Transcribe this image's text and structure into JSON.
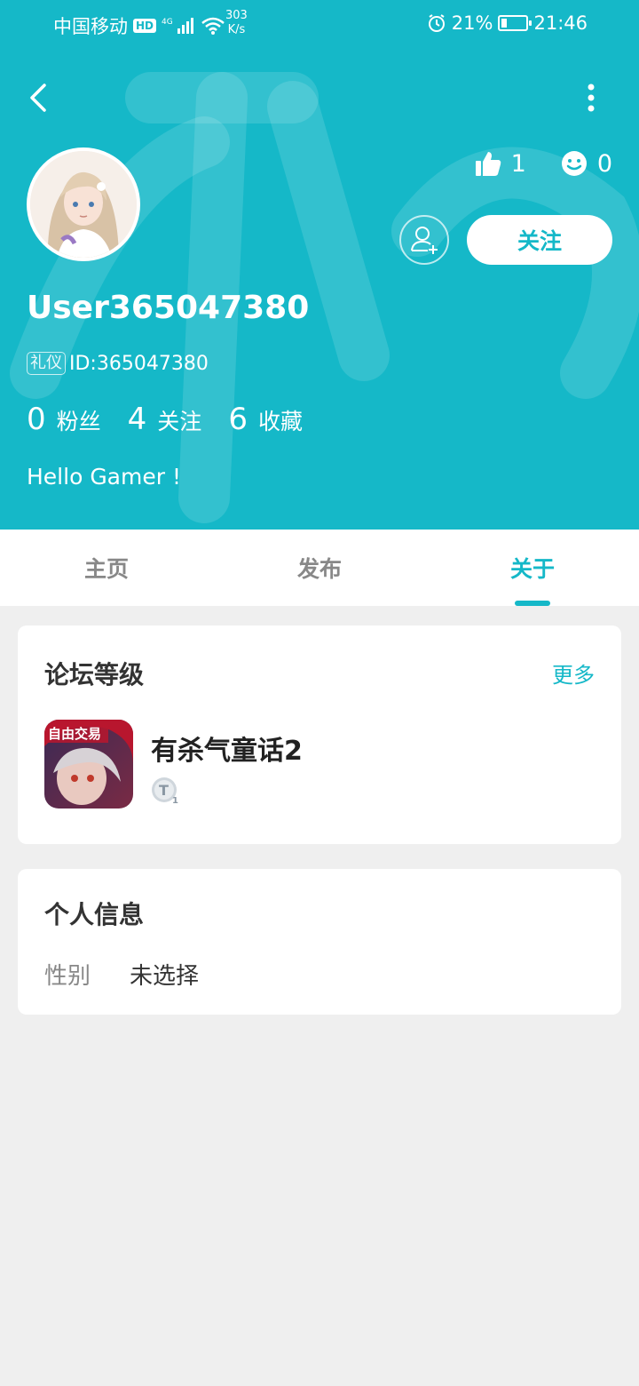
{
  "status_bar": {
    "carrier": "中国移动",
    "hd_badge": "HD",
    "network": "4G",
    "speed_value": "303",
    "speed_unit": "K/s",
    "battery": "21%",
    "time": "21:46"
  },
  "profile": {
    "likes": "1",
    "smiles": "0",
    "follow_button": "关注",
    "username": "User365047380",
    "badge": "礼仪",
    "id_text": "ID:365047380",
    "counts": [
      {
        "num": "0",
        "label": "粉丝"
      },
      {
        "num": "4",
        "label": "关注"
      },
      {
        "num": "6",
        "label": "收藏"
      }
    ],
    "bio": "Hello Gamer !"
  },
  "tabs": [
    {
      "label": "主页",
      "active": false
    },
    {
      "label": "发布",
      "active": false
    },
    {
      "label": "关于",
      "active": true
    }
  ],
  "forum_level": {
    "title": "论坛等级",
    "more": "更多",
    "game_name": "有杀气童话2",
    "game_icon_banner": "自由交易",
    "level_badge_letter": "T",
    "level_badge_number": "1"
  },
  "personal_info": {
    "title": "个人信息",
    "gender_label": "性别",
    "gender_value": "未选择"
  },
  "colors": {
    "brand": "#15b8c8",
    "background": "#efefef"
  }
}
